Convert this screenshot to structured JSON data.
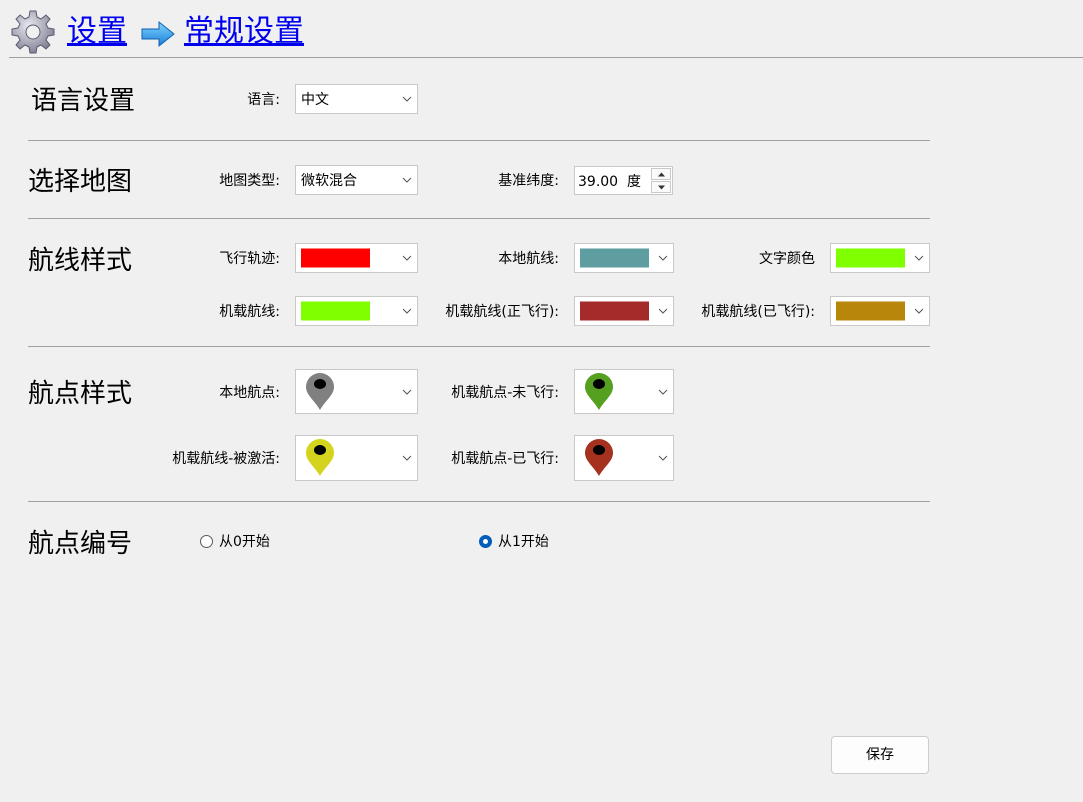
{
  "header": {
    "breadcrumb_root": "设置",
    "breadcrumb_current": "常规设置",
    "gear_icon": "gear-icon",
    "arrow_icon": "arrow-right-icon"
  },
  "language": {
    "title": "语言设置",
    "label": "语言:",
    "value": "中文"
  },
  "map": {
    "title": "选择地图",
    "type_label": "地图类型:",
    "type_value": "微软混合",
    "lat_label": "基准纬度:",
    "lat_value": "39.00",
    "lat_unit": "度"
  },
  "route_style": {
    "title": "航线样式",
    "flight_track": {
      "label": "飞行轨迹:",
      "color": "#ff0000"
    },
    "local_route": {
      "label": "本地航线:",
      "color": "#5f9ea0"
    },
    "text_color": {
      "label": "文字颜色",
      "color": "#7fff00"
    },
    "onboard_route": {
      "label": "机载航线:",
      "color": "#7fff00"
    },
    "onboard_route_flying": {
      "label": "机载航线(正飞行):",
      "color": "#a52a2a"
    },
    "onboard_route_flown": {
      "label": "机载航线(已飞行):",
      "color": "#b8860b"
    }
  },
  "waypoint_style": {
    "title": "航点样式",
    "local_point": {
      "label": "本地航点:",
      "color": "#808080"
    },
    "onboard_not_flown": {
      "label": "机载航点-未飞行:",
      "color": "#55a020"
    },
    "onboard_activated": {
      "label": "机载航线-被激活:",
      "color": "#d4d41e"
    },
    "onboard_flown": {
      "label": "机载航点-已飞行:",
      "color": "#a5321e"
    }
  },
  "numbering": {
    "title": "航点编号",
    "option0": "从0开始",
    "option1": "从1开始",
    "selected": "从1开始"
  },
  "save_label": "保存"
}
